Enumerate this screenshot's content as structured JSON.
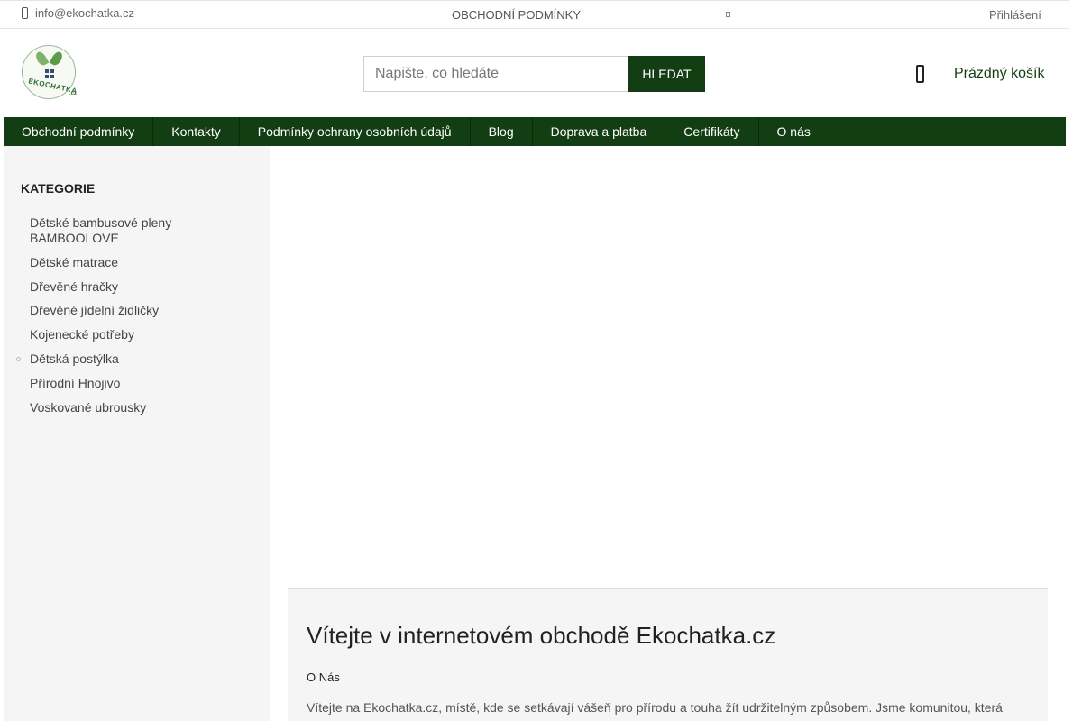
{
  "topbar": {
    "email": "info@ekochatka.cz",
    "terms_link": "OBCHODNÍ PODMÍNKY",
    "login": "Přihlášení"
  },
  "header": {
    "logo_text": "EKOCHATKA",
    "logo_suffix": ".cz",
    "search_placeholder": "Napište, co hledáte",
    "search_button": "HLEDAT",
    "cart_label": "Prázdný košík"
  },
  "nav": {
    "items": [
      "Obchodní podmínky",
      "Kontakty",
      "Podmínky ochrany osobních údajů",
      "Blog",
      "Doprava a platba",
      "Certifikáty",
      "O nás"
    ]
  },
  "sidebar": {
    "title": "KATEGORIE",
    "items": [
      "Dětské bambusové pleny BAMBOOLOVE",
      "Dětské matrace",
      "Dřevěné hračky",
      "Dřevěné jídelní židličky",
      "Kojenecké potřeby",
      "Dětská postýlka",
      "Přírodní Hnojivo",
      "Voskované ubrousky"
    ]
  },
  "welcome": {
    "title": "Vítejte v internetovém obchodě Ekochatka.cz",
    "subtitle": "O Nás",
    "text": "Vítejte na Ekochatka.cz, místě, kde se setkávají vášeň pro přírodu a touha žít udržitelným způsobem. Jsme komunitou, která"
  }
}
